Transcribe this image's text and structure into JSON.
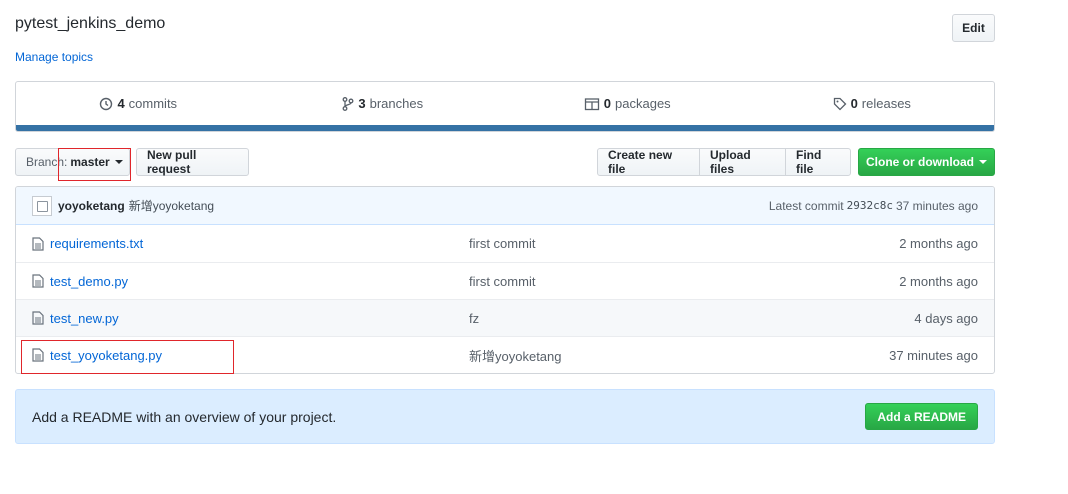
{
  "repo": {
    "description": "pytest_jenkins_demo",
    "manage_topics": "Manage topics",
    "edit_label": "Edit"
  },
  "summary": {
    "commits": {
      "count": "4",
      "label": "commits",
      "icon": "history-icon"
    },
    "branches": {
      "count": "3",
      "label": "branches",
      "icon": "branch-icon"
    },
    "packages": {
      "count": "0",
      "label": "packages",
      "icon": "package-icon"
    },
    "releases": {
      "count": "0",
      "label": "releases",
      "icon": "tag-icon"
    },
    "language_color": "#3572A5"
  },
  "toolbar": {
    "branch_label": "Branch:",
    "branch_value": "master",
    "new_pull_request": "New pull request",
    "create_new_file": "Create new file",
    "upload_files": "Upload files",
    "find_file": "Find file",
    "clone_or_download": "Clone or download"
  },
  "latest_commit": {
    "author": "yoyoketang",
    "message": "新增yoyoketang",
    "prefix": "Latest commit",
    "sha": "2932c8c",
    "age": "37 minutes ago"
  },
  "files": [
    {
      "name": "requirements.txt",
      "message": "first commit",
      "age": "2 months ago"
    },
    {
      "name": "test_demo.py",
      "message": "first commit",
      "age": "2 months ago"
    },
    {
      "name": "test_new.py",
      "message": "fz",
      "age": "4 days ago"
    },
    {
      "name": "test_yoyoketang.py",
      "message": "新增yoyoketang",
      "age": "37 minutes ago"
    }
  ],
  "readme": {
    "text": "Add a README with an overview of your project.",
    "button": "Add a README"
  },
  "colors": {
    "link": "#0366d6",
    "primary_green": "#28a745",
    "annotation_red": "#e0262b"
  }
}
